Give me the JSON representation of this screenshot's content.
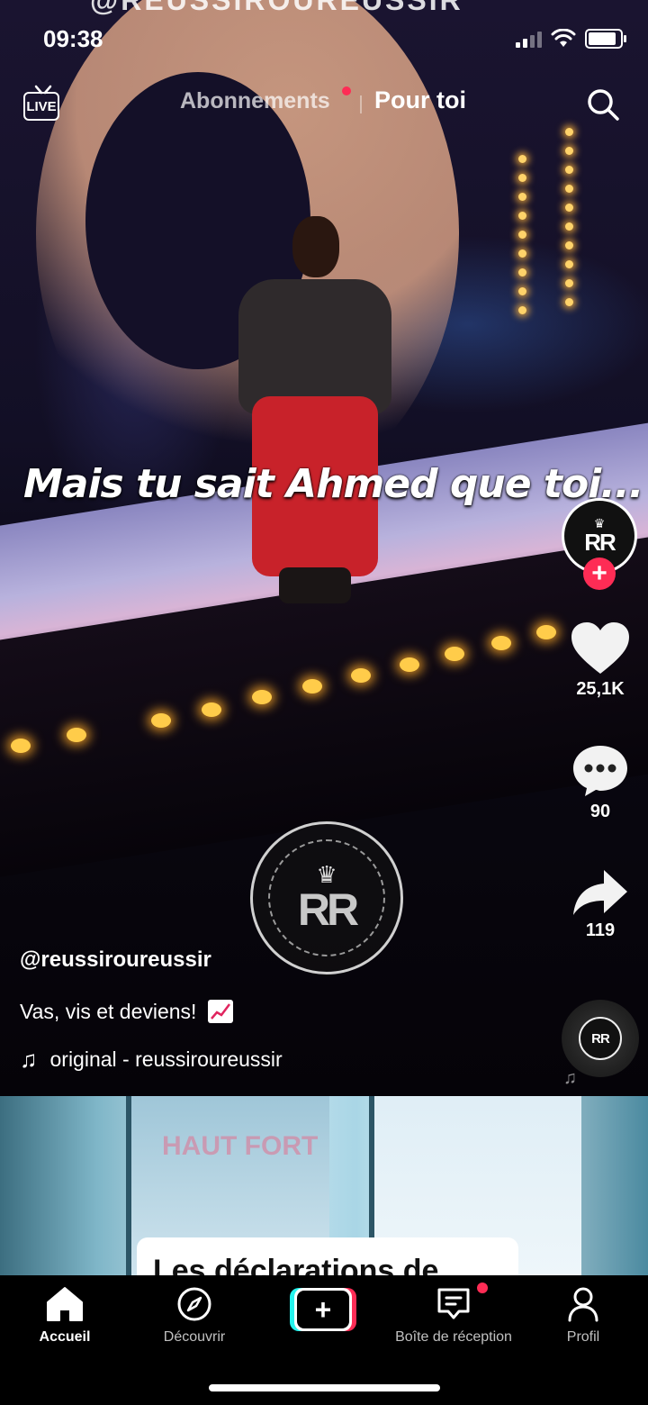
{
  "status_bar": {
    "time": "09:38"
  },
  "video_overlay": {
    "faded_top_text": "@REUSSIROUREUSSIR",
    "subtitle": "Mais tu sait Ahmed que toi...",
    "watermark_letters": "RR"
  },
  "top_nav": {
    "live_label": "LIVE",
    "following_tab": "Abonnements",
    "for_you_tab": "Pour toi"
  },
  "right_rail": {
    "avatar_letters": "RR",
    "follow_symbol": "+",
    "like_count": "25,1K",
    "comment_count": "90",
    "share_count": "119",
    "disc_letters": "RR"
  },
  "caption": {
    "username": "@reussiroureussir",
    "description": "Vas, vis et deviens!",
    "sound": "original - reussiroureussir"
  },
  "next_video": {
    "sign_text": "HAUT FORT",
    "caption_card": "Les déclarations de"
  },
  "bottom_nav": {
    "items": [
      {
        "label": "Accueil",
        "icon": "home-icon",
        "active": true
      },
      {
        "label": "Découvrir",
        "icon": "compass-icon",
        "active": false
      },
      {
        "label": "",
        "icon": "create-plus-icon",
        "active": false
      },
      {
        "label": "Boîte de réception",
        "icon": "inbox-icon",
        "active": false
      },
      {
        "label": "Profil",
        "icon": "profile-icon",
        "active": false
      }
    ]
  },
  "colors": {
    "accent_red": "#fe2c55",
    "accent_cyan": "#25f4ee",
    "background": "#000000"
  }
}
